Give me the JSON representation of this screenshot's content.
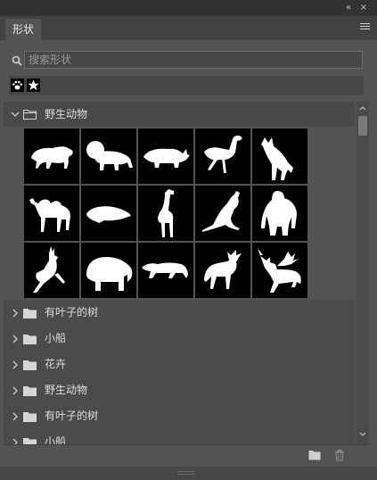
{
  "window": {
    "collapse_glyph": "«",
    "close_glyph": "×"
  },
  "panel": {
    "tab_label": "形状",
    "menu_icon": "hamburger-icon"
  },
  "search": {
    "placeholder": "搜索形状",
    "value": ""
  },
  "recent_shapes": [
    "paw-print",
    "star"
  ],
  "groups": [
    {
      "label": "野生动物",
      "expanded": true,
      "shapes": [
        "tiger",
        "lion",
        "rhinoceros",
        "ostrich",
        "wolf",
        "camel",
        "mole",
        "giraffe",
        "kangaroo",
        "gorilla",
        "gazelle",
        "elephant",
        "panther",
        "moose",
        "deer"
      ]
    },
    {
      "label": "有叶子的树",
      "expanded": false
    },
    {
      "label": "小船",
      "expanded": false
    },
    {
      "label": "花卉",
      "expanded": false
    },
    {
      "label": "野生动物",
      "expanded": false
    },
    {
      "label": "有叶子的树",
      "expanded": false
    },
    {
      "label": "小船",
      "expanded": false
    }
  ],
  "toolbar": {
    "new_group_icon": "folder-icon",
    "delete_icon": "trash-icon"
  }
}
